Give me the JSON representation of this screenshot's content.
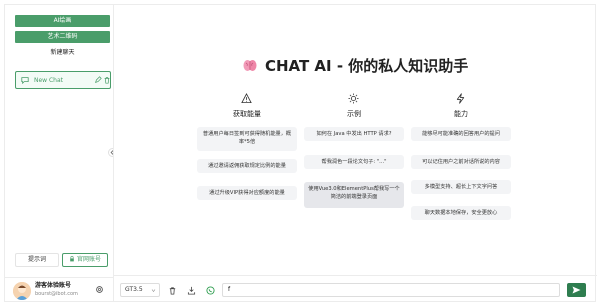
{
  "sidebar": {
    "ai_paint_label": "AI绘画",
    "qrcode_label": "艺术二维码",
    "new_chat_label": "新建聊天",
    "chats": [
      {
        "title": "New Chat"
      }
    ],
    "tabs": [
      {
        "label": "提示词"
      },
      {
        "label": "官网账号"
      }
    ],
    "user": {
      "name": "游客体验账号",
      "email": "bourst@ibot.com"
    }
  },
  "main": {
    "headline": "CHAT AI - 你的私人知识助手",
    "columns": [
      {
        "icon": "warning-icon",
        "title": "获取能量",
        "cards": [
          "普通用户每日签到可获得随机能量，概率*5倍",
          "通过邀请返佣获取规定比例的能量",
          "通过升级VIP获得对应额度的能量"
        ]
      },
      {
        "icon": "sun-icon",
        "title": "示例",
        "cards": [
          "如何在 Java 中发出 HTTP 请求?",
          "帮我润色一段论文句子: \"...\"",
          "使用Vue3.0和ElementPlus帮我写一个简洁的前端登录页面"
        ]
      },
      {
        "icon": "lightning-icon",
        "title": "能力",
        "cards": [
          "能够尽可能准确的回答用户的提问",
          "可以记住用户之前对话所说的内容",
          "多模型支持、超长上下文字问答",
          "聊天数据本地保存，安全更放心"
        ]
      }
    ]
  },
  "composer": {
    "model": "GT3.5",
    "input_value": "f"
  },
  "colors": {
    "accent": "#4a9d6a",
    "send": "#2e7d4f",
    "card_bg": "#f3f4f6"
  }
}
